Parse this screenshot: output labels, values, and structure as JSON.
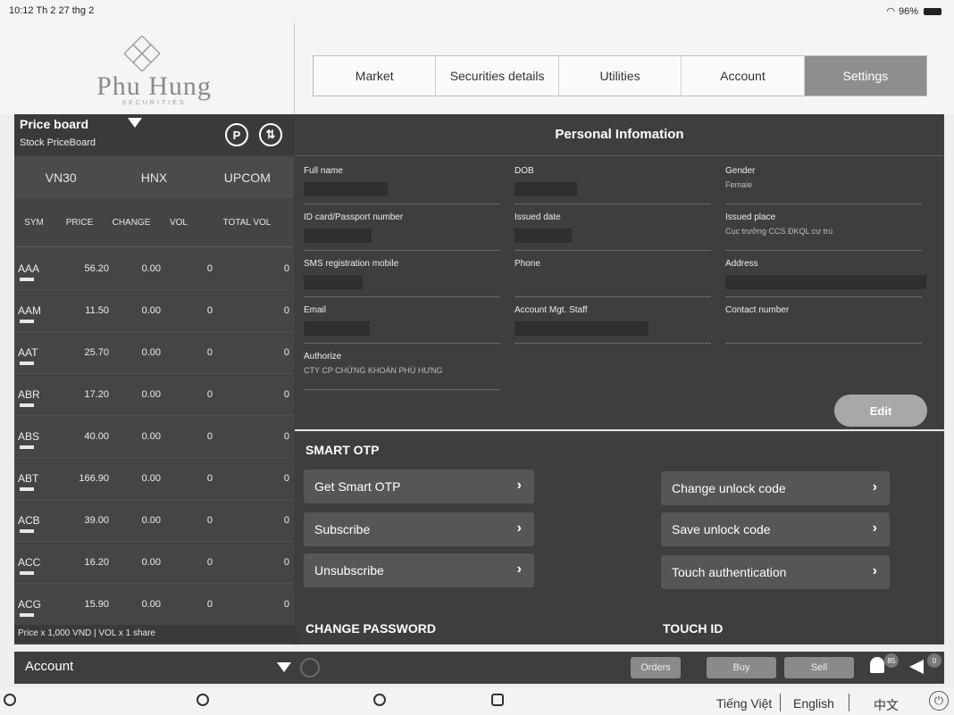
{
  "status_bar": {
    "left": "10:12  Th 2 27 thg 2",
    "battery": "96%"
  },
  "logo": {
    "name": "Phu Hung",
    "tagline": "SECURITIES"
  },
  "nav": {
    "tabs": [
      "Market",
      "Securities details",
      "Utilities",
      "Account",
      "Settings"
    ],
    "active": "Settings"
  },
  "price_board": {
    "title": "Price board",
    "subtitle": "Stock PriceBoard",
    "markets": [
      "VN30",
      "HNX",
      "UPCOM"
    ],
    "columns": [
      "SYM",
      "PRICE",
      "CHANGE",
      "VOL",
      "TOTAL VOL"
    ],
    "rows": [
      {
        "sym": "AAA",
        "price": "56.20",
        "change": "0.00",
        "vol": "0",
        "tvol": "0"
      },
      {
        "sym": "AAM",
        "price": "11.50",
        "change": "0.00",
        "vol": "0",
        "tvol": "0"
      },
      {
        "sym": "AAT",
        "price": "25.70",
        "change": "0.00",
        "vol": "0",
        "tvol": "0"
      },
      {
        "sym": "ABR",
        "price": "17.20",
        "change": "0.00",
        "vol": "0",
        "tvol": "0"
      },
      {
        "sym": "ABS",
        "price": "40.00",
        "change": "0.00",
        "vol": "0",
        "tvol": "0"
      },
      {
        "sym": "ABT",
        "price": "166.90",
        "change": "0.00",
        "vol": "0",
        "tvol": "0"
      },
      {
        "sym": "ACB",
        "price": "39.00",
        "change": "0.00",
        "vol": "0",
        "tvol": "0"
      },
      {
        "sym": "ACC",
        "price": "16.20",
        "change": "0.00",
        "vol": "0",
        "tvol": "0"
      },
      {
        "sym": "ACG",
        "price": "15.90",
        "change": "0.00",
        "vol": "0",
        "tvol": "0"
      }
    ],
    "footer": "Price x 1,000 VND | VOL x 1 share"
  },
  "personal": {
    "title": "Personal Infomation",
    "fields": {
      "full_name": {
        "label": "Full name"
      },
      "dob": {
        "label": "DOB"
      },
      "gender": {
        "label": "Gender",
        "value": "Female"
      },
      "id_card": {
        "label": "ID card/Passport number"
      },
      "issued_date": {
        "label": "Issued date"
      },
      "issued_place": {
        "label": "Issued place",
        "value": "Cục trưởng CCS ĐKQL cư trú"
      },
      "sms_mobile": {
        "label": "SMS registration mobile"
      },
      "phone": {
        "label": "Phone"
      },
      "address": {
        "label": "Address"
      },
      "email": {
        "label": "Email"
      },
      "account_staff": {
        "label": "Account Mgt. Staff"
      },
      "contact_number": {
        "label": "Contact number"
      },
      "authorize": {
        "label": "Authorize",
        "value": "CTY CP CHỨNG KHOÁN PHÚ HƯNG"
      }
    },
    "edit_label": "Edit"
  },
  "smart_otp": {
    "title": "SMART OTP",
    "left_buttons": [
      "Get Smart OTP",
      "Subscribe",
      "Unsubscribe"
    ],
    "right_buttons": [
      "Change unlock code",
      "Save unlock code",
      "Touch authentication"
    ]
  },
  "change_password": {
    "title": "CHANGE PASSWORD"
  },
  "touch_id": {
    "title": "TOUCH ID"
  },
  "account_bar": {
    "label": "Account",
    "orders": "Orders",
    "buy": "Buy",
    "sell": "Sell",
    "notif_count": "85",
    "announce_count": "0"
  },
  "footer": {
    "languages": [
      "Tiếng Việt",
      "English",
      "中文"
    ]
  }
}
